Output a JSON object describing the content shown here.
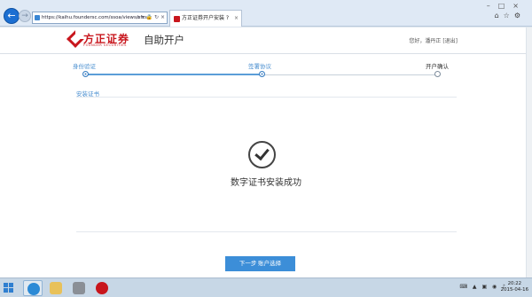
{
  "browser": {
    "url": "https://kaihu.foundersc.com/ssoa/views/sfzs/k",
    "url_controls": "⌕ ▾ 🔒 ↻ ×",
    "tab_title": "方正证券开户安装 ?",
    "tab_close": "×",
    "window_controls": "–□×",
    "tool_icons": "⌂☆⚙"
  },
  "header": {
    "logo_text": "方正证券",
    "logo_sub": "FOUNDER SECURITIES",
    "title": "自助开户",
    "user_text": "您好，潘丹正 [退出]"
  },
  "steps": [
    {
      "label": "身份验证",
      "state": "done"
    },
    {
      "label": "签署协议",
      "state": "done"
    },
    {
      "label": "开户确认",
      "state": "pending"
    }
  ],
  "progress_fraction": 0.5,
  "sub_step": "安装证书",
  "main": {
    "success_text": "数字证书安装成功",
    "next_button": "下一步 账户选择"
  },
  "taskbar": {
    "tray": "⌨ ▲ ▣ ◉ ♪",
    "clock_time": "20:22",
    "clock_date": "2015-04-16"
  },
  "colors": {
    "brand_red": "#c8161d",
    "accent_blue": "#3c8ed8"
  },
  "icons": [
    "back-arrow-icon",
    "forward-arrow-icon",
    "page-icon",
    "home-icon",
    "star-icon",
    "gear-icon",
    "checkmark-icon",
    "windows-start-icon",
    "ie-icon",
    "folder-icon",
    "app-icon"
  ]
}
